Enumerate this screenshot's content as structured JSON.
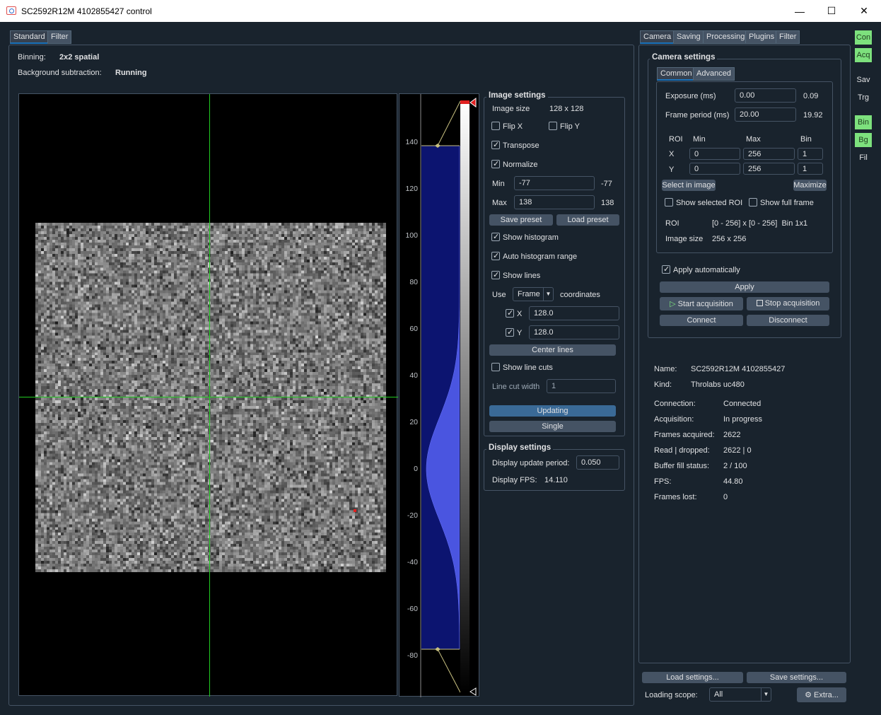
{
  "window": {
    "title": "SC2592R12M 4102855427 control",
    "minimize": "—",
    "maximize": "☐",
    "close": "✕"
  },
  "left_tabs": [
    "Standard",
    "Filter"
  ],
  "info": {
    "binning_label": "Binning:",
    "binning_value": "2x2 spatial",
    "bg_label": "Background subtraction:",
    "bg_value": "Running"
  },
  "histogram": {
    "ticks": [
      "140",
      "120",
      "100",
      "80",
      "60",
      "40",
      "20",
      "0",
      "-20",
      "-40",
      "-60",
      "-80"
    ]
  },
  "image_settings": {
    "title": "Image settings",
    "image_size_label": "Image size",
    "image_size_value": "128 x 128",
    "flip_x": "Flip X",
    "flip_y": "Flip Y",
    "transpose": "Transpose",
    "normalize": "Normalize",
    "min_label": "Min",
    "min_value": "-77",
    "min_actual": "-77",
    "max_label": "Max",
    "max_value": "138",
    "max_actual": "138",
    "save_preset": "Save preset",
    "load_preset": "Load preset",
    "show_histogram": "Show histogram",
    "auto_histogram_range": "Auto histogram range",
    "show_lines": "Show lines",
    "use_label": "Use",
    "use_value": "Frame",
    "coordinates_label": "coordinates",
    "x_label": "X",
    "x_value": "128.0",
    "y_label": "Y",
    "y_value": "128.0",
    "center_lines": "Center lines",
    "show_line_cuts": "Show line cuts",
    "line_cut_width_label": "Line cut width",
    "line_cut_width_value": "1",
    "updating": "Updating",
    "single": "Single"
  },
  "display_settings": {
    "title": "Display settings",
    "period_label": "Display update period:",
    "period_value": "0.050",
    "fps_label": "Display FPS:",
    "fps_value": "14.110"
  },
  "right_tabs": [
    "Camera",
    "Saving",
    "Processing",
    "Plugins",
    "Filter"
  ],
  "camera_settings": {
    "title": "Camera settings",
    "tabs": [
      "Common",
      "Advanced"
    ],
    "exposure_label": "Exposure (ms)",
    "exposure_value": "0.00",
    "exposure_actual": "0.09",
    "frame_period_label": "Frame period (ms)",
    "frame_period_value": "20.00",
    "frame_period_actual": "19.92",
    "roi_header": [
      "ROI",
      "Min",
      "Max",
      "Bin"
    ],
    "roi_x": {
      "label": "X",
      "min": "0",
      "max": "256",
      "bin": "1"
    },
    "roi_y": {
      "label": "Y",
      "min": "0",
      "max": "256",
      "bin": "1"
    },
    "select_in_image": "Select in image",
    "maximize": "Maximize",
    "show_selected_roi": "Show selected ROI",
    "show_full_frame": "Show full frame",
    "roi_label": "ROI",
    "roi_value": "[0 - 256] x [0 - 256]  Bin 1x1",
    "image_size_label": "Image size",
    "image_size_value": "256 x 256",
    "apply_automatically": "Apply automatically",
    "apply": "Apply",
    "start_acquisition": "Start acquisition",
    "stop_acquisition": "Stop acquisition",
    "connect": "Connect",
    "disconnect": "Disconnect"
  },
  "status": {
    "name_label": "Name:",
    "name_value": "SC2592R12M 4102855427",
    "kind_label": "Kind:",
    "kind_value": "Throlabs uc480",
    "connection_label": "Connection:",
    "connection_value": "Connected",
    "acquisition_label": "Acquisition:",
    "acquisition_value": "In progress",
    "frames_label": "Frames acquired:",
    "frames_value": "2622",
    "read_label": "Read | dropped:",
    "read_value": "2622 | 0",
    "buffer_label": "Buffer fill status:",
    "buffer_value": "2 / 100",
    "fps_label": "FPS:",
    "fps_value": "44.80",
    "lost_label": "Frames lost:",
    "lost_value": "0"
  },
  "bottom": {
    "load_settings": "Load settings...",
    "save_settings": "Save settings...",
    "scope_label": "Loading scope:",
    "scope_value": "All",
    "extra": "Extra..."
  },
  "side_indicators": [
    "Con",
    "Acq",
    "Sav",
    "Trg",
    "Bin",
    "Bg",
    "Fil"
  ],
  "colors": {
    "background": "#19232d",
    "green_indicator": "#7de17d",
    "crosshair": "#22cc22",
    "histogram_fill": "#4a55e0"
  }
}
